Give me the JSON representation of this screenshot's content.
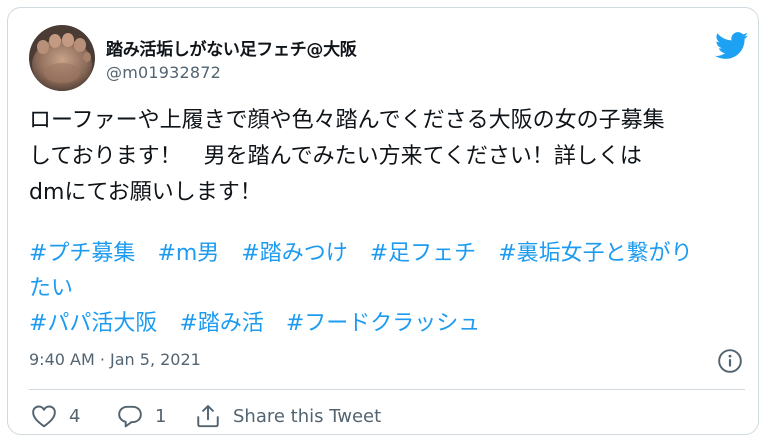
{
  "tweet": {
    "author": {
      "display_name": "踏み活垢しがない足フェチ@大阪",
      "handle": "@m01932872"
    },
    "text_lines": [
      "ローファーや上履きで顔や色々踏んでくださる大阪の女の子募集",
      "しております！　男を踏んでみたい方来てください！詳しくは",
      "dmにてお願いします！"
    ],
    "hashtag_rows": [
      [
        "#プチ募集",
        "#m男",
        "#踏みつけ",
        "#足フェチ",
        "#裏垢女子と繋がり"
      ],
      [
        "たい"
      ],
      [
        "#パパ活大阪",
        "#踏み活",
        "#フードクラッシュ"
      ]
    ],
    "timestamp": "9:40 AM · Jan 5, 2021",
    "actions": {
      "like_count": "4",
      "reply_count": "1",
      "share_label": "Share this Tweet"
    }
  },
  "colors": {
    "link": "#1d9bf0",
    "muted": "#536471",
    "border": "#cfd9de",
    "text": "#0f1419",
    "twitter_blue": "#1da1f2"
  },
  "icons": [
    "twitter-bird-icon",
    "info-icon",
    "heart-icon",
    "reply-bubble-icon",
    "share-icon"
  ]
}
